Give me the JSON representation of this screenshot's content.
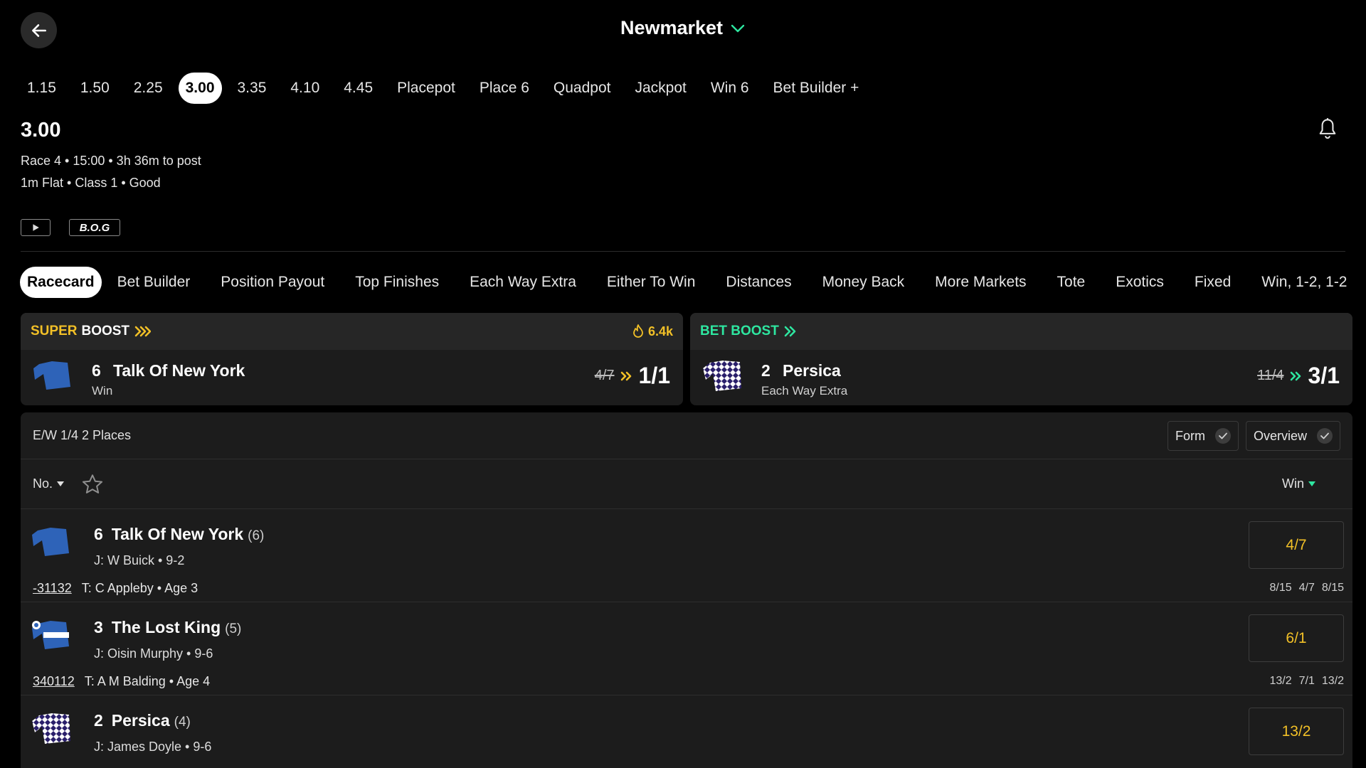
{
  "header": {
    "venue": "Newmarket"
  },
  "race_tabs": [
    "1.15",
    "1.50",
    "2.25",
    "3.00",
    "3.35",
    "4.10",
    "4.45",
    "Placepot",
    "Place 6",
    "Quadpot",
    "Jackpot",
    "Win 6",
    "Bet Builder +"
  ],
  "race_tabs_active": "3.00",
  "race": {
    "time": "3.00",
    "info_line1": "Race 4 • 15:00 • 3h 36m to post",
    "info_line2": "1m Flat  • Class 1  • Good",
    "bog_label": "B.O.G"
  },
  "market_tabs": [
    "Racecard",
    "Bet Builder",
    "Position Payout",
    "Top Finishes",
    "Each Way Extra",
    "Either To Win",
    "Distances",
    "Money Back",
    "More Markets",
    "Tote",
    "Exotics",
    "Fixed",
    "Win, 1-2, 1-2"
  ],
  "market_tabs_active": "Racecard",
  "super_boost": {
    "label_super": "SUPER",
    "label_boost": "BOOST",
    "popularity": "6.4k",
    "number": "6",
    "horse": "Talk Of New York",
    "market": "Win",
    "old_odds": "4/7",
    "new_odds": "1/1",
    "accent": "#f2c027"
  },
  "bet_boost": {
    "label": "BET BOOST",
    "number": "2",
    "horse": "Persica",
    "market": "Each Way Extra",
    "old_odds": "11/4",
    "new_odds": "3/1",
    "accent": "#2ee6a0"
  },
  "list": {
    "ew_terms": "E/W 1/4 2 Places",
    "form_toggle": "Form",
    "overview_toggle": "Overview",
    "sort_no": "No.",
    "sort_win": "Win"
  },
  "runners": [
    {
      "number": "6",
      "name": "Talk Of New York",
      "draw": "(6)",
      "jockey": "J: W Buick • 9-2",
      "form": "-31132",
      "trainer": "T: C Appleby • Age 3",
      "odds": "4/7",
      "history": [
        "8/15",
        "4/7",
        "8/15"
      ]
    },
    {
      "number": "3",
      "name": "The Lost King",
      "draw": "(5)",
      "jockey": "J: Oisin Murphy • 9-6",
      "form": "340112",
      "trainer": "T: A M Balding • Age 4",
      "odds": "6/1",
      "history": [
        "13/2",
        "7/1",
        "13/2"
      ]
    },
    {
      "number": "2",
      "name": "Persica",
      "draw": "(4)",
      "jockey": "J: James Doyle • 9-6",
      "form": "",
      "trainer": "",
      "odds": "13/2",
      "history": []
    }
  ]
}
